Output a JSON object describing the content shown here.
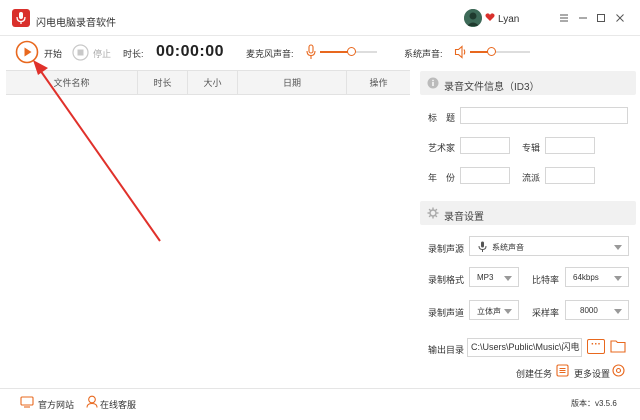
{
  "app": {
    "title": "闪电电脑录音软件",
    "username": "Lyan",
    "accent_color": "#e8681e",
    "logo_color": "#d9302c"
  },
  "toolbar": {
    "start_label": "开始",
    "stop_label": "停止",
    "duration_label": "时长:",
    "duration_value": "00:00:00",
    "mic_label": "麦克风声音:",
    "system_label": "系统声音:",
    "mic_level": 0.55,
    "system_level": 0.35
  },
  "table": {
    "columns": [
      "文件名称",
      "时长",
      "大小",
      "日期",
      "操作"
    ],
    "rows": []
  },
  "id3": {
    "section_title": "录音文件信息（ID3）",
    "title_label": "标　题",
    "artist_label": "艺术家",
    "album_label": "专辑",
    "year_label": "年　份",
    "genre_label": "流派",
    "title_value": "",
    "artist_value": "",
    "album_value": "",
    "year_value": "",
    "genre_value": ""
  },
  "settings": {
    "section_title": "录音设置",
    "source_label": "录制声源",
    "source_value": "系统声音",
    "format_label": "录制格式",
    "format_value": "MP3",
    "bitrate_label": "比特率",
    "bitrate_value": "64kbps",
    "channel_label": "录制声道",
    "channel_value": "立体声",
    "samplerate_label": "采样率",
    "samplerate_value": "8000",
    "output_label": "输出目录",
    "output_value": "C:\\Users\\Public\\Music\\闪电",
    "create_task_label": "创建任务",
    "more_settings_label": "更多设置"
  },
  "footer": {
    "website_label": "官方网站",
    "support_label": "在线客服",
    "version_label": "版本：v3.5.6"
  }
}
